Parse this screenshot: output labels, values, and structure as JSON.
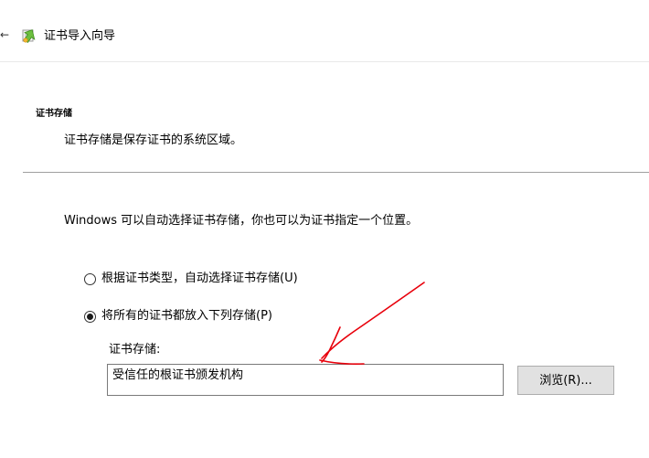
{
  "window": {
    "back_glyph": "←",
    "title": "证书导入向导",
    "icon": "certificate-wizard-icon"
  },
  "section": {
    "title": "证书存储",
    "description": "证书存储是保存证书的系统区域。"
  },
  "main": {
    "intro": "Windows 可以自动选择证书存储，你也可以为证书指定一个位置。",
    "options": [
      {
        "label": "根据证书类型，自动选择证书存储(U)",
        "checked": false
      },
      {
        "label": "将所有的证书都放入下列存储(P)",
        "checked": true
      }
    ],
    "store_label": "证书存储:",
    "store_value": "受信任的根证书颁发机构",
    "browse_label": "浏览(R)..."
  },
  "colors": {
    "annotation": "#e8000b",
    "divider": "#a0a0a0",
    "button_bg": "#e1e1e1"
  }
}
